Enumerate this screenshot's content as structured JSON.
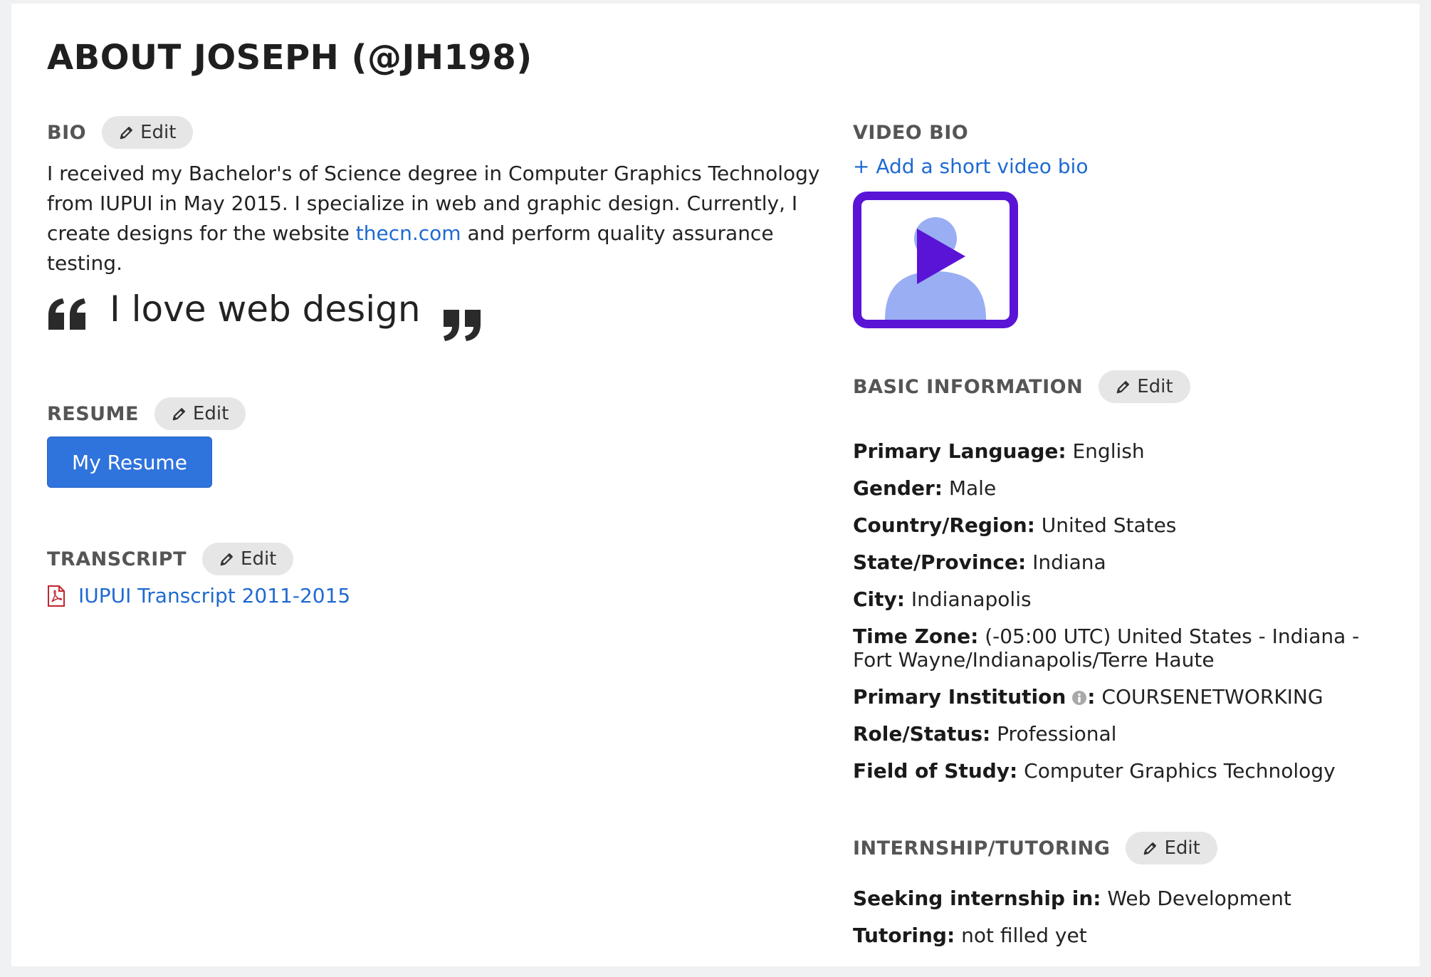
{
  "page": {
    "title": "ABOUT JOSEPH (@JH198)"
  },
  "edit_label": "Edit",
  "bio": {
    "label": "BIO",
    "text_before_link": "I received my Bachelor's of Science degree in Computer Graphics Technology from IUPUI in May 2015. I specialize in web and graphic design. Currently, I create designs for the website ",
    "link_text": "thecn.com",
    "text_after_link": " and perform quality assurance testing."
  },
  "quote": {
    "text": "I love web design"
  },
  "resume": {
    "label": "RESUME",
    "button_label": "My Resume"
  },
  "transcript": {
    "label": "TRANSCRIPT",
    "file_name": "IUPUI Transcript 2011-2015"
  },
  "video_bio": {
    "label": "VIDEO BIO",
    "add_link": "+ Add a short video bio"
  },
  "basic_info": {
    "label": "BASIC INFORMATION",
    "rows": [
      {
        "key": "Primary Language:",
        "value": "English"
      },
      {
        "key": "Gender:",
        "value": "Male"
      },
      {
        "key": "Country/Region:",
        "value": "United States"
      },
      {
        "key": "State/Province:",
        "value": "Indiana"
      },
      {
        "key": "City:",
        "value": "Indianapolis"
      },
      {
        "key": "Time Zone:",
        "value": "(-05:00 UTC) United States - Indiana - Fort Wayne/Indianapolis/Terre Haute"
      },
      {
        "key": "Primary Institution",
        "key_suffix": ":",
        "value": "COURSENETWORKING",
        "icon": "info-icon"
      },
      {
        "key": "Role/Status:",
        "value": "Professional"
      },
      {
        "key": "Field of Study:",
        "value": "Computer Graphics Technology"
      }
    ]
  },
  "internship": {
    "label": "INTERNSHIP/TUTORING",
    "rows": [
      {
        "key": "Seeking internship in:",
        "value": "Web Development"
      },
      {
        "key": "Tutoring:",
        "value": "not filled yet"
      }
    ]
  },
  "colors": {
    "link": "#1f6ad1",
    "primary_button": "#2f73dc",
    "video_frame": "#5a14d6",
    "video_avatar": "#9aaef3",
    "pdf_icon": "#c0262d"
  }
}
